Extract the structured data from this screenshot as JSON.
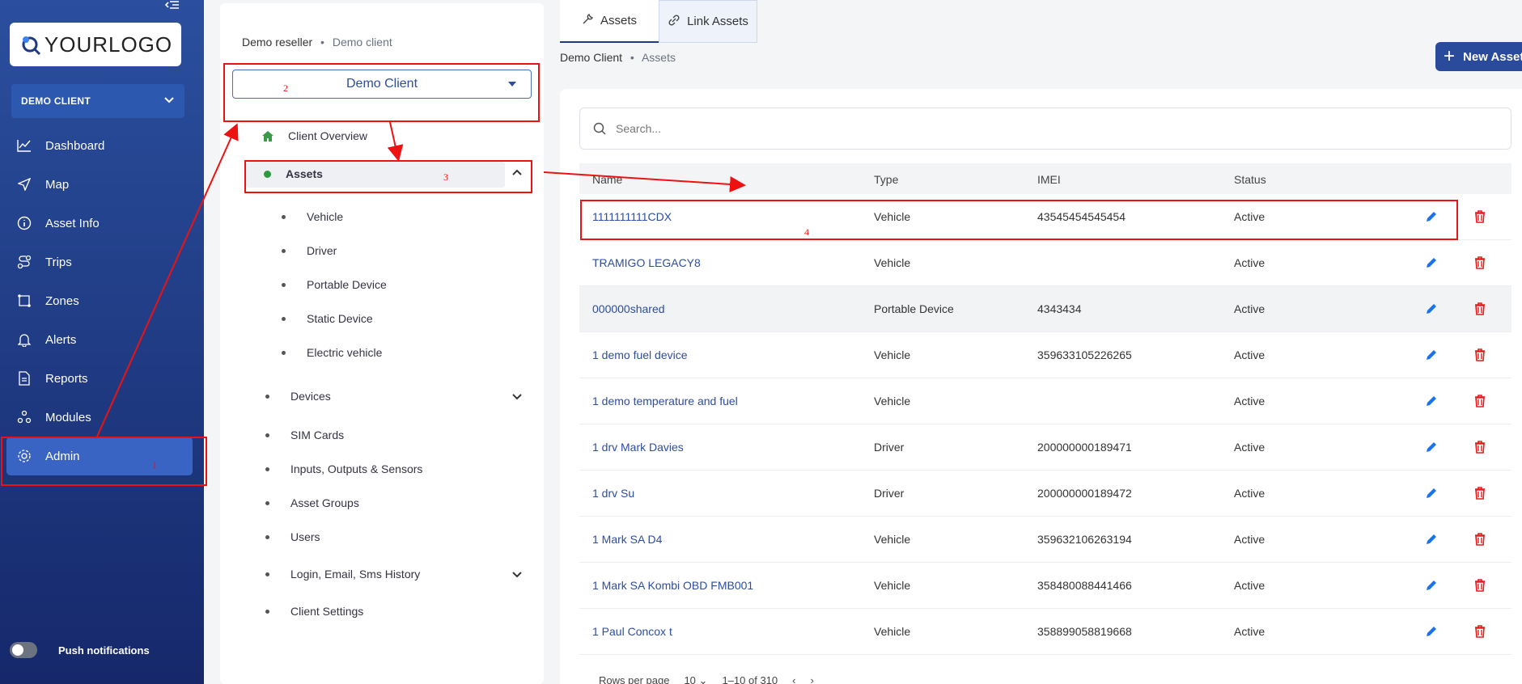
{
  "sidebar": {
    "logo_text": "YOURLOGO",
    "client_selector": "DEMO CLIENT",
    "items": [
      {
        "label": "Dashboard",
        "icon": "chart-line-icon"
      },
      {
        "label": "Map",
        "icon": "navigation-arrow-icon"
      },
      {
        "label": "Asset Info",
        "icon": "info-circle-icon"
      },
      {
        "label": "Trips",
        "icon": "route-icon"
      },
      {
        "label": "Zones",
        "icon": "zone-polygon-icon"
      },
      {
        "label": "Alerts",
        "icon": "bell-icon"
      },
      {
        "label": "Reports",
        "icon": "document-icon"
      },
      {
        "label": "Modules",
        "icon": "modules-icon"
      },
      {
        "label": "Admin",
        "icon": "gear-icon",
        "active": true
      }
    ],
    "push_label": "Push notifications"
  },
  "mid": {
    "breadcrumb": {
      "first": "Demo reseller",
      "sep": "•",
      "second": "Demo client"
    },
    "client_dropdown": "Demo Client",
    "tree": {
      "client_overview": "Client Overview",
      "assets": "Assets",
      "asset_children": [
        "Vehicle",
        "Driver",
        "Portable Device",
        "Static Device",
        "Electric vehicle"
      ],
      "devices": "Devices",
      "sim_cards": "SIM Cards",
      "io_sensors": "Inputs, Outputs & Sensors",
      "asset_groups": "Asset Groups",
      "users": "Users",
      "history": "Login, Email, Sms History",
      "client_settings": "Client Settings"
    }
  },
  "main": {
    "tabs": [
      "Assets",
      "Link Assets"
    ],
    "breadcrumb": {
      "first": "Demo Client",
      "sep": "•",
      "second": "Assets"
    },
    "new_button": "New Asset",
    "search_placeholder": "Search...",
    "columns": [
      "Name",
      "Type",
      "IMEI",
      "Status"
    ],
    "rows": [
      {
        "name": "1111111111CDX",
        "type": "Vehicle",
        "imei": "43545454545454",
        "status": "Active"
      },
      {
        "name": "TRAMIGO LEGACY8",
        "type": "Vehicle",
        "imei": "",
        "status": "Active"
      },
      {
        "name": "000000shared",
        "type": "Portable Device",
        "imei": "4343434",
        "status": "Active"
      },
      {
        "name": "1 demo fuel device",
        "type": "Vehicle",
        "imei": "359633105226265",
        "status": "Active"
      },
      {
        "name": "1 demo temperature and fuel",
        "type": "Vehicle",
        "imei": "",
        "status": "Active"
      },
      {
        "name": "1 drv Mark Davies",
        "type": "Driver",
        "imei": "200000000189471",
        "status": "Active"
      },
      {
        "name": "1 drv Su",
        "type": "Driver",
        "imei": "200000000189472",
        "status": "Active"
      },
      {
        "name": "1 Mark SA D4",
        "type": "Vehicle",
        "imei": "359632106263194",
        "status": "Active"
      },
      {
        "name": "1 Mark SA Kombi OBD FMB001",
        "type": "Vehicle",
        "imei": "358480088441466",
        "status": "Active"
      },
      {
        "name": "1 Paul Concox t",
        "type": "Vehicle",
        "imei": "358899058819668",
        "status": "Active"
      }
    ],
    "pager": {
      "rows_label": "Rows per page",
      "rows_value": "10",
      "range": "1–10 of 310"
    }
  },
  "annotations": [
    "1",
    "2",
    "3",
    "4"
  ],
  "colors": {
    "sidebar": "#1f3a82",
    "accent": "#2a4a9c",
    "link": "#2d4d9e",
    "edit": "#1a73e8",
    "delete": "#e11d1d",
    "annotation": "#e11111"
  }
}
